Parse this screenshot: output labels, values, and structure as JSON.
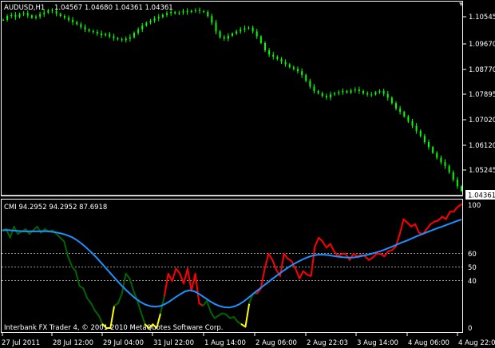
{
  "window": {
    "symbol_title": "AUDUSD,H1",
    "ohlc": "1.04567 1.04680 1.04361 1.04361"
  },
  "price_pane": {
    "price_ticks": [
      "1.10545",
      "1.09670",
      "1.08770",
      "1.07895",
      "1.07020",
      "1.06120",
      "1.05245"
    ],
    "current_price": "1.04361"
  },
  "indicator_pane": {
    "title": "CMI 94.2952 94.2952 87.6918",
    "levels": [
      "100",
      "60",
      "50",
      "40",
      "0"
    ],
    "copyright": "Interbank FX Trader 4, © 2001-2010 MetaQuotes Software Corp."
  },
  "time_axis": [
    "27 Jul 2011",
    "28 Jul 12:00",
    "29 Jul 04:00",
    "31 Jul 22:00",
    "1 Aug 14:00",
    "2 Aug 06:00",
    "2 Aug 22:03",
    "3 Aug 14:00",
    "4 Aug 06:00",
    "4 Aug 22:00"
  ],
  "colors": {
    "background": "#000000",
    "candles": "#00ff00",
    "grid_frame": "#ffffff",
    "cmi_down": "#ff0000",
    "cmi_flat": "#006400",
    "cmi_extreme": "#ffff00",
    "signal": "#1e90ff",
    "current_price_box": "#ffffff"
  },
  "chart_data": [
    {
      "type": "line",
      "title": "AUDUSD,H1",
      "x_ticks": [
        "27 Jul 2011",
        "28 Jul 12:00",
        "29 Jul 04:00",
        "31 Jul 22:00",
        "1 Aug 14:00",
        "2 Aug 06:00",
        "2 Aug 22:03",
        "3 Aug 14:00",
        "4 Aug 06:00",
        "4 Aug 22:00"
      ],
      "y_ticks": [
        1.10545,
        1.0967,
        1.0877,
        1.07895,
        1.0702,
        1.0612,
        1.05245
      ],
      "ylim": [
        1.042,
        1.1085
      ],
      "series": [
        {
          "name": "AUDUSD",
          "values": [
            1.1025,
            1.1038,
            1.1042,
            1.1035,
            1.1045,
            1.1048,
            1.104,
            1.1032,
            1.1036,
            1.1045,
            1.105,
            1.1058,
            1.1055,
            1.1046,
            1.1038,
            1.1032,
            1.1025,
            1.1017,
            1.101,
            1.1,
            1.0992,
            1.0986,
            1.0983,
            1.0978,
            1.0972,
            1.0976,
            1.0968,
            1.0962,
            1.0958,
            1.0955,
            1.096,
            1.0965,
            1.098,
            1.0992,
            1.1005,
            1.1015,
            1.1022,
            1.103,
            1.1035,
            1.1042,
            1.1048,
            1.1052,
            1.1047,
            1.105,
            1.1055,
            1.1052,
            1.1056,
            1.1058,
            1.1055,
            1.1052,
            1.1038,
            1.1015,
            1.0985,
            1.0965,
            1.096,
            1.097,
            1.0978,
            1.0985,
            1.0992,
            1.0996,
            1.0998,
            1.0985,
            1.0968,
            1.0945,
            1.092,
            1.0905,
            1.0898,
            1.089,
            1.088,
            1.0872,
            1.0862,
            1.0856,
            1.0848,
            1.0835,
            1.0815,
            1.0795,
            1.078,
            1.0772,
            1.0763,
            1.0758,
            1.0768,
            1.0772,
            1.0776,
            1.078,
            1.0775,
            1.0782,
            1.0785,
            1.078,
            1.0772,
            1.0768,
            1.0768,
            1.0776,
            1.078,
            1.077,
            1.0757,
            1.0738,
            1.072,
            1.0708,
            1.0692,
            1.0676,
            1.066,
            1.0643,
            1.0625,
            1.0604,
            1.0587,
            1.0567,
            1.055,
            1.0535,
            1.0522,
            1.05,
            1.0475,
            1.0452,
            1.0436
          ]
        }
      ]
    },
    {
      "type": "line",
      "title": "CMI 94.2952 94.2952 87.6918",
      "y_ticks": [
        100,
        60,
        50,
        40,
        0
      ],
      "ylim": [
        0,
        100
      ],
      "series": [
        {
          "name": "CMI",
          "values": [
            79,
            80,
            73,
            82,
            76,
            78,
            80,
            76,
            79,
            82,
            77,
            80,
            78,
            79,
            76,
            73,
            70,
            58,
            50,
            46,
            34,
            32,
            24,
            20,
            14,
            10,
            3,
            0,
            0,
            18,
            20,
            28,
            44,
            40,
            30,
            22,
            12,
            3,
            0,
            3,
            0,
            12,
            26,
            44,
            38,
            48,
            44,
            36,
            48,
            30,
            44,
            20,
            18,
            22,
            13,
            8,
            10,
            12,
            11,
            8,
            9,
            5,
            3,
            1,
            20,
            28,
            28,
            32,
            48,
            60,
            55,
            47,
            42,
            60,
            56,
            54,
            48,
            40,
            46,
            43,
            42,
            66,
            73,
            70,
            65,
            68,
            62,
            58,
            60,
            60,
            55,
            60,
            58,
            59,
            58,
            55,
            57,
            60,
            60,
            58,
            62,
            63,
            66,
            76,
            88,
            85,
            82,
            84,
            77,
            76,
            80,
            84,
            86,
            87,
            90,
            88,
            94,
            94,
            98,
            100
          ]
        },
        {
          "name": "Signal",
          "values": [
            79,
            79.3,
            78.9,
            78.5,
            78.2,
            78.1,
            78.2,
            78.1,
            78.3,
            78.2,
            77.8,
            77.2,
            76.4,
            75.2,
            73.6,
            71.3,
            68.4,
            65,
            61.3,
            57.2,
            52.8,
            48.3,
            43.8,
            39.3,
            35,
            30.9,
            27.2,
            23.8,
            21,
            18.9,
            17.7,
            17.3,
            17.8,
            19.5,
            21.9,
            24.7,
            27.3,
            29.6,
            30.6,
            29.5,
            27.2,
            24.5,
            21.8,
            19.5,
            17.8,
            16.8,
            16.6,
            17.5,
            19.2,
            21.9,
            25,
            28.3,
            31.4,
            34.5,
            37.6,
            40.7,
            43.6,
            46.5,
            49.2,
            51.7,
            53.9,
            55.8,
            57.5,
            58.7,
            59.3,
            59.3,
            59,
            58.3,
            57.7,
            57.3,
            57,
            57,
            57.5,
            58.4,
            59.3,
            60.3,
            61.4,
            62.7,
            64.3,
            65.9,
            67.6,
            69.3,
            70.8,
            72.6,
            74.3,
            75.9,
            77.5,
            79,
            80.5,
            81.9,
            83.4,
            84.9,
            86.4,
            87.7
          ]
        }
      ]
    }
  ]
}
